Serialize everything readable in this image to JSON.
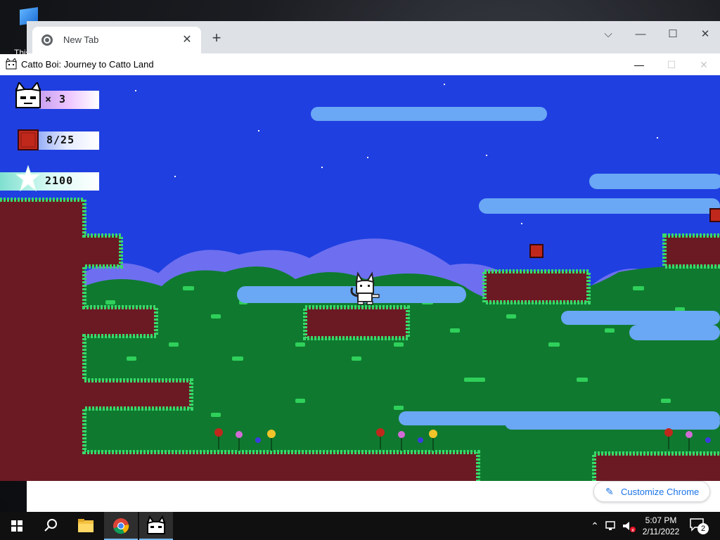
{
  "desktop": {
    "icon_label": "This"
  },
  "chrome": {
    "tab_title": "New Tab",
    "tab_close": "✕",
    "new_tab": "+",
    "controls": {
      "dropdown": "⌵",
      "minimize": "—",
      "maximize": "☐",
      "close": "✕"
    },
    "customize_label": "Customize Chrome",
    "customize_icon": "pencil-icon"
  },
  "game_window": {
    "title": "Catto Boi: Journey to Catto Land",
    "controls": {
      "minimize": "—",
      "maximize": "☐",
      "close": "✕"
    }
  },
  "hud": {
    "lives": "× 3",
    "crates": "8/25",
    "score": "2100"
  },
  "colors": {
    "sky": "#1f3fe0",
    "far_hills": "#6d6ff0",
    "foliage": "#0f7a2f",
    "foliage_light": "#2fd05a",
    "dirt": "#6b1a24",
    "grass": "#39d96a",
    "cloud": "#6aa7f5",
    "crate": "#c0281c"
  },
  "taskbar": {
    "time": "5:07 PM",
    "date": "2/11/2022",
    "notifications": "2"
  }
}
